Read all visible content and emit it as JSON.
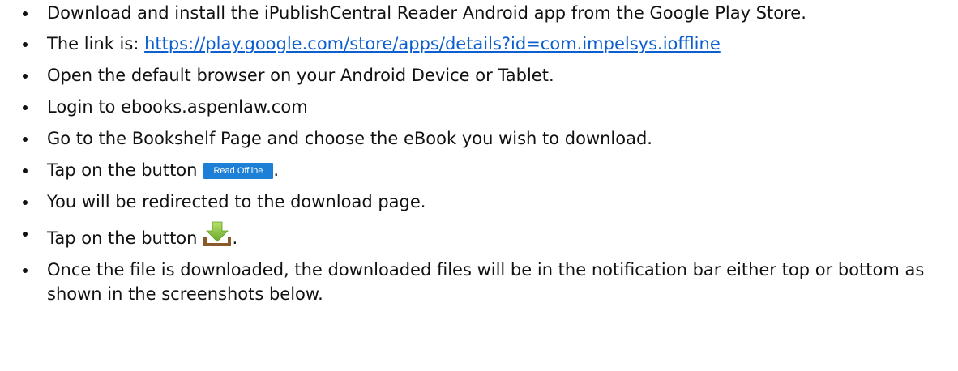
{
  "steps": [
    {
      "text": "Download and install the iPublishCentral Reader Android app from the Google Play Store."
    },
    {
      "prefix": "The link is: ",
      "link_text": "https://play.google.com/store/apps/details?id=com.impelsys.ioffline"
    },
    {
      "text": "Open the default browser on your Android Device or Tablet."
    },
    {
      "text": "Login to ebooks.aspenlaw.com"
    },
    {
      "text": "Go to the Bookshelf Page and choose the eBook you wish to download."
    },
    {
      "prefix": "Tap on the button",
      "button_label": "Read Offline",
      "suffix": "."
    },
    {
      "text": "You will be redirected to the download page."
    },
    {
      "prefix": "Tap on the button",
      "icon": "download-icon",
      "suffix": "."
    },
    {
      "text": "Once the file is downloaded, the downloaded files will be in the notification bar either top or bottom as shown in the screenshots below."
    }
  ],
  "colors": {
    "link": "#0b5fd0",
    "button_bg": "#1e7fd6",
    "icon_arrow": "#8cc63f",
    "icon_tray": "#8b5a2b"
  }
}
